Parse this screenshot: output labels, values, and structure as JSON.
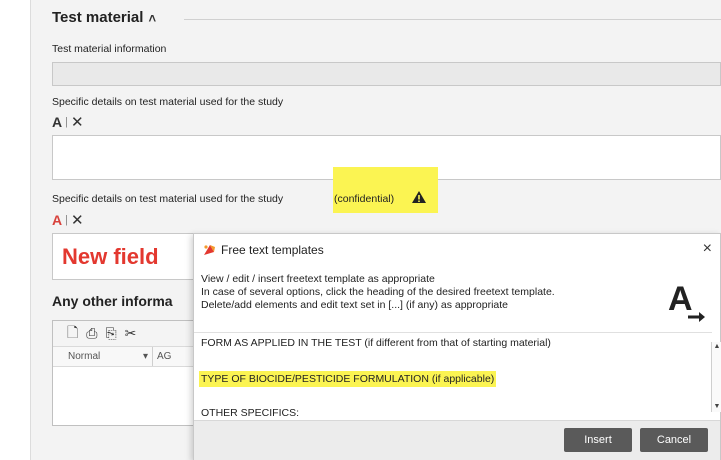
{
  "section": {
    "title": "Test material",
    "collapse_icon": "chevron-up-icon"
  },
  "fields": {
    "test_material_information_label": "Test material information",
    "specific_details_label": "Specific details on test material used for the study",
    "specific_details_conf_label_prefix": "Specific details on test material used for the study",
    "specific_details_conf_label_suffix": "(confidential)",
    "new_field_annotation": "New field",
    "any_other_info_label": "Any other informa"
  },
  "toolbar_icons": {
    "template_icon": "A",
    "separator": "|",
    "delete_icon": "✕"
  },
  "editor": {
    "style_value": "Normal",
    "font_value": "AG"
  },
  "dialog": {
    "title": "Free text templates",
    "close_label": "×",
    "line1": "View / edit / insert freetext template as appropriate",
    "line2": "In case of several options, click the heading of the desired freetext template.",
    "line3": "Delete/add elements and edit text set in [...] (if any) as appropriate",
    "big_icon": "A",
    "templates": [
      "FORM AS APPLIED IN THE TEST (if different from that of starting material)",
      "TYPE OF BIOCIDE/PESTICIDE FORMULATION (if applicable)",
      "OTHER SPECIFICS:"
    ],
    "insert_label": "Insert",
    "cancel_label": "Cancel"
  },
  "colors": {
    "highlight": "#fbf452",
    "new_field_red": "#e3382f",
    "button_dark": "#5a5a5a"
  }
}
